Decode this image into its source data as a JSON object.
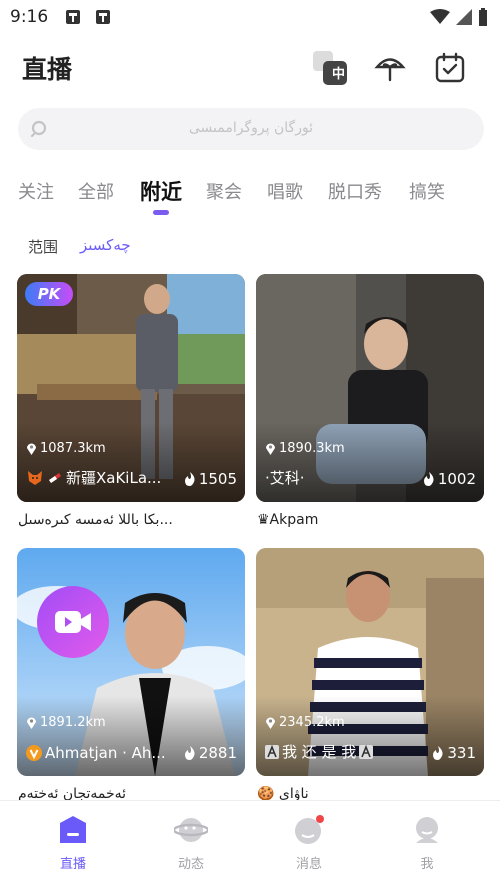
{
  "status_bar": {
    "time": "9:16",
    "notification_icons": [
      "bug-icon",
      "bug-icon"
    ],
    "right_icons": [
      "wifi-icon",
      "signal-icon",
      "battery-icon"
    ]
  },
  "header": {
    "title": "直播",
    "translate_badge": "中",
    "actions": [
      "translate-icon",
      "umbrella-icon",
      "calendar-check-icon"
    ]
  },
  "search": {
    "placeholder": "ئورگان پروگراممىسى"
  },
  "tabs": [
    {
      "label": "关注",
      "active": false
    },
    {
      "label": "全部",
      "active": false
    },
    {
      "label": "附近",
      "active": true
    },
    {
      "label": "聚会",
      "active": false
    },
    {
      "label": "唱歌",
      "active": false
    },
    {
      "label": "脱口秀",
      "active": false
    },
    {
      "label": "搞笑",
      "active": false
    }
  ],
  "filter": {
    "label": "范围",
    "value": "چەكسىز"
  },
  "cards": [
    {
      "distance": "1087.3km",
      "name": "新疆XaKiLa...",
      "views": "1505",
      "caption": "بكا باللا ئەمسە كىرەسىل...",
      "badge": "PK",
      "name_icons": [
        "fox-avatar-icon",
        "flag-icon"
      ]
    },
    {
      "distance": "1890.3km",
      "name": "·艾科·",
      "views": "1002",
      "caption": "♛Akpam",
      "badge": "",
      "name_icons": []
    },
    {
      "distance": "1891.2km",
      "name": "Ahmatjan · Ah...",
      "views": "2881",
      "caption": "ئەخمەتجان ئەختەم",
      "badge": "video-call-icon",
      "name_icons": [
        "v-badge-icon"
      ]
    },
    {
      "distance": "2345.2km",
      "name": "我 还 是 我",
      "views": "331",
      "caption": "🍪 ناۋاي",
      "badge": "",
      "name_icons": [
        "letter-a-icon",
        "letter-a-icon"
      ]
    }
  ],
  "bottom_nav": [
    {
      "label": "直播",
      "active": true,
      "icon": "live-home-icon"
    },
    {
      "label": "动态",
      "active": false,
      "icon": "planet-icon"
    },
    {
      "label": "消息",
      "active": false,
      "icon": "message-bubble-icon"
    },
    {
      "label": "我",
      "active": false,
      "icon": "profile-icon"
    }
  ],
  "colors": {
    "accent": "#6a5af9",
    "tab_underline": "#7b5cf0",
    "unread_dot": "#f0464a"
  }
}
